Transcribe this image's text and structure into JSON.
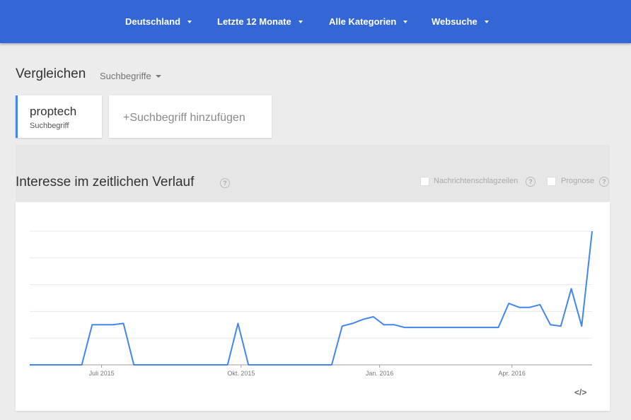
{
  "filters": {
    "region": "Deutschland",
    "time": "Letzte 12 Monate",
    "category": "Alle Kategorien",
    "search_type": "Websuche"
  },
  "compare": {
    "title": "Vergleichen",
    "mode": "Suchbegriffe"
  },
  "terms": [
    {
      "name": "proptech",
      "type": "Suchbegriff"
    }
  ],
  "add_term": {
    "plus": "+",
    "label": "Suchbegriff hinzufügen"
  },
  "interest_section": {
    "title": "Interesse im zeitlichen Verlauf",
    "help": "?",
    "options": [
      {
        "label": "Nachrichtenschlagzeilen",
        "checked": false
      },
      {
        "label": "Prognose",
        "checked": false
      }
    ]
  },
  "embed_label": "</>",
  "colors": {
    "header": "#3367d6",
    "line": "#4285f4",
    "accent": "#4285f4"
  },
  "chart_data": {
    "type": "line",
    "series": [
      {
        "values": [
          0,
          0,
          0,
          0,
          0,
          0,
          30,
          30,
          30,
          31,
          0,
          0,
          0,
          0,
          0,
          0,
          0,
          0,
          0,
          0,
          31,
          0,
          0,
          0,
          0,
          0,
          0,
          0,
          0,
          0,
          29,
          31,
          34,
          36,
          30,
          30,
          28,
          28,
          28,
          28,
          28,
          28,
          28,
          28,
          28,
          28,
          46,
          43,
          43,
          45,
          30,
          29,
          57,
          29,
          100
        ]
      }
    ],
    "x_tick_labels": [
      {
        "label": "Juli 2015",
        "index": 6.9
      },
      {
        "label": "Okt. 2015",
        "index": 20.3
      },
      {
        "label": "Jan. 2016",
        "index": 33.6
      },
      {
        "label": "Apr. 2016",
        "index": 46.3
      }
    ],
    "ylim": [
      0,
      100
    ],
    "grid": true
  }
}
